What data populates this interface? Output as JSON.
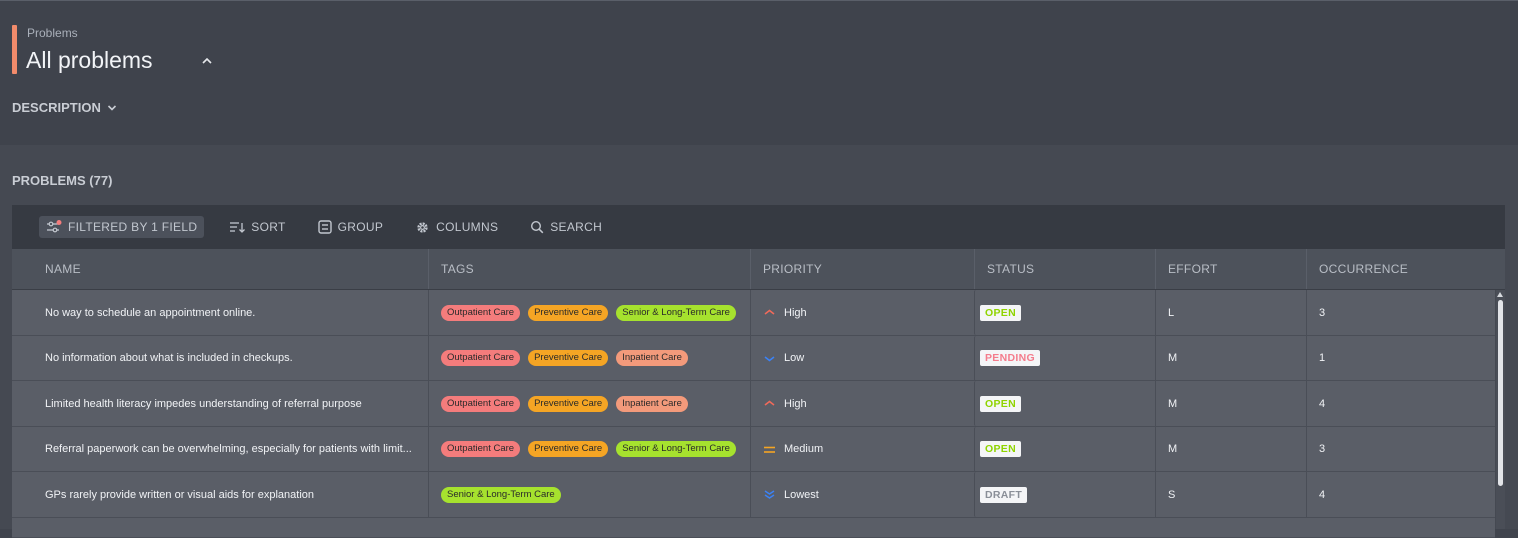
{
  "header": {
    "breadcrumb": "Problems",
    "title": "All problems",
    "description_label": "DESCRIPTION",
    "accent_color": "#f28b6b"
  },
  "section": {
    "title": "PROBLEMS (77)"
  },
  "toolbar": {
    "filter_label": "FILTERED BY 1 FIELD",
    "sort_label": "SORT",
    "group_label": "GROUP",
    "columns_label": "COLUMNS",
    "search_label": "SEARCH"
  },
  "table": {
    "columns": [
      "NAME",
      "TAGS",
      "PRIORITY",
      "STATUS",
      "EFFORT",
      "OCCURRENCE"
    ],
    "rows": [
      {
        "name": "No way to schedule an appointment online.",
        "tags": [
          {
            "label": "Outpatient Care",
            "color": "#f47c7c"
          },
          {
            "label": "Preventive Care",
            "color": "#f5a524"
          },
          {
            "label": "Senior & Long-Term Care",
            "color": "#a6e22e"
          }
        ],
        "priority": "High",
        "priority_icon": "chevron-up-icon",
        "priority_color": "#f06a5a",
        "status": "OPEN",
        "status_color": "#8fd400",
        "effort": "L",
        "occurrence": "3"
      },
      {
        "name": "No information about what is included in checkups.",
        "tags": [
          {
            "label": "Outpatient Care",
            "color": "#f47c7c"
          },
          {
            "label": "Preventive Care",
            "color": "#f5a524"
          },
          {
            "label": "Inpatient Care",
            "color": "#f39a7b"
          }
        ],
        "priority": "Low",
        "priority_icon": "chevron-down-icon",
        "priority_color": "#3b82f6",
        "status": "PENDING",
        "status_color": "#f47c8c",
        "effort": "M",
        "occurrence": "1"
      },
      {
        "name": "Limited health literacy impedes understanding of referral purpose",
        "tags": [
          {
            "label": "Outpatient Care",
            "color": "#f47c7c"
          },
          {
            "label": "Preventive Care",
            "color": "#f5a524"
          },
          {
            "label": "Inpatient Care",
            "color": "#f39a7b"
          }
        ],
        "priority": "High",
        "priority_icon": "chevron-up-icon",
        "priority_color": "#f06a5a",
        "status": "OPEN",
        "status_color": "#8fd400",
        "effort": "M",
        "occurrence": "4"
      },
      {
        "name": "Referral paperwork can be overwhelming, especially for patients with limit...",
        "tags": [
          {
            "label": "Outpatient Care",
            "color": "#f47c7c"
          },
          {
            "label": "Preventive Care",
            "color": "#f5a524"
          },
          {
            "label": "Senior & Long-Term Care",
            "color": "#a6e22e"
          }
        ],
        "priority": "Medium",
        "priority_icon": "equals-icon",
        "priority_color": "#f5a524",
        "status": "OPEN",
        "status_color": "#8fd400",
        "effort": "M",
        "occurrence": "3"
      },
      {
        "name": "GPs rarely provide written or visual aids for explanation",
        "tags": [
          {
            "label": "Senior & Long-Term Care",
            "color": "#a6e22e"
          }
        ],
        "priority": "Lowest",
        "priority_icon": "double-chevron-down-icon",
        "priority_color": "#3b82f6",
        "status": "DRAFT",
        "status_color": "#8a8f98",
        "effort": "S",
        "occurrence": "4"
      }
    ]
  }
}
